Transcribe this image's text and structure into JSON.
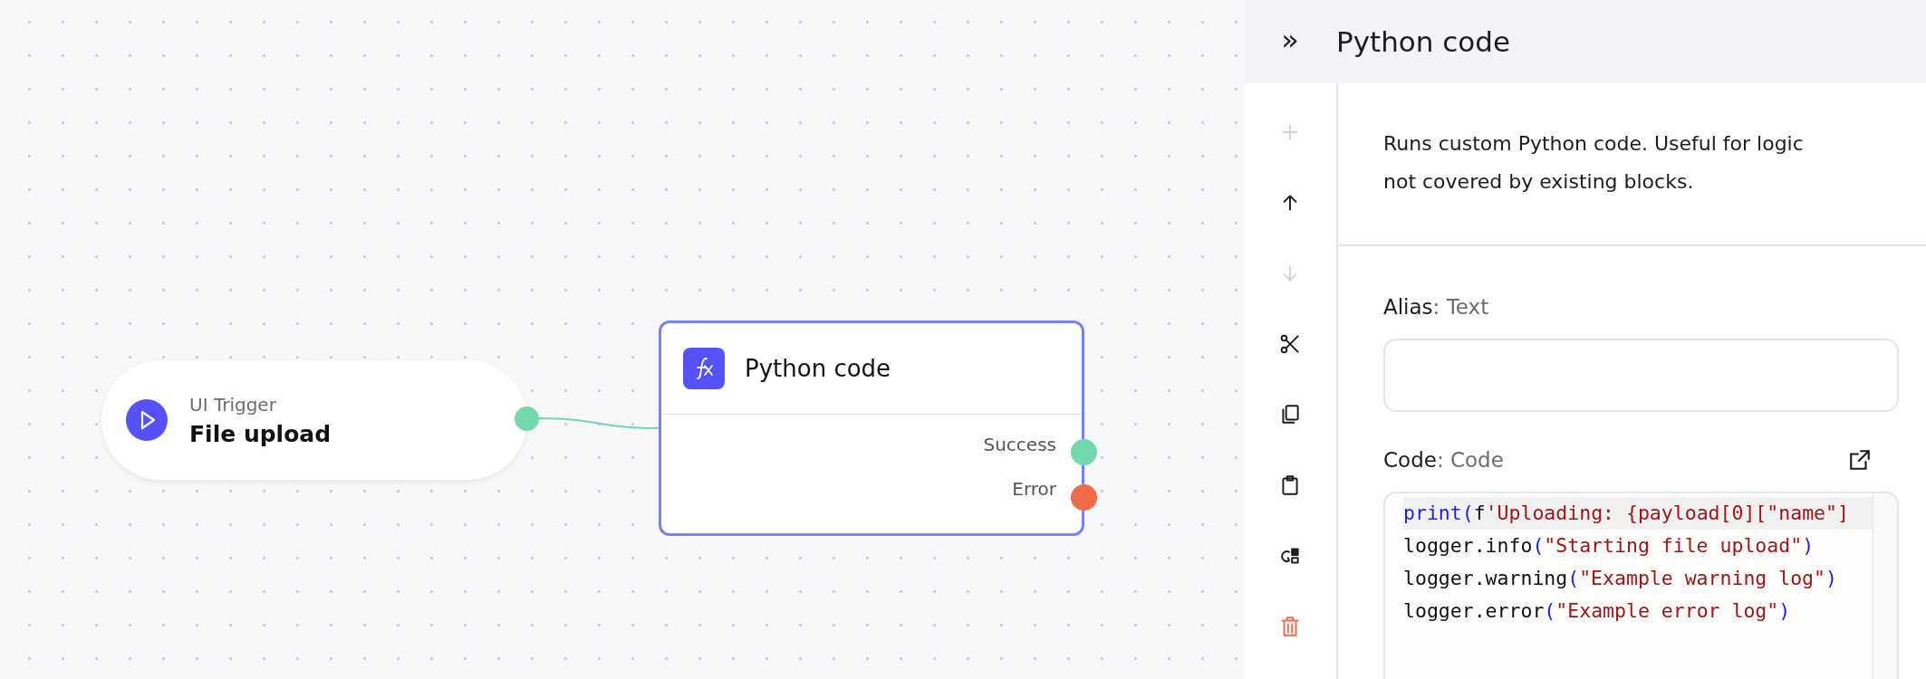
{
  "canvas": {
    "trigger_node": {
      "subtitle": "UI Trigger",
      "title": "File upload"
    },
    "code_node": {
      "title": "Python code",
      "outputs": [
        {
          "label": "Success",
          "color": "#72d8ae"
        },
        {
          "label": "Error",
          "color": "#ef6c47"
        }
      ]
    }
  },
  "panel": {
    "collapse_icon": "»",
    "title": "Python code",
    "toolbar": [
      {
        "kind": "add",
        "disabled": true
      },
      {
        "kind": "up",
        "disabled": false
      },
      {
        "kind": "down",
        "disabled": true
      },
      {
        "kind": "cut",
        "disabled": false
      },
      {
        "kind": "copy",
        "disabled": false
      },
      {
        "kind": "paste",
        "disabled": false
      },
      {
        "kind": "replace",
        "disabled": false
      },
      {
        "kind": "delete",
        "disabled": false
      }
    ],
    "description": "Runs custom Python code. Useful for logic not covered by existing blocks.",
    "fields": [
      {
        "label": "Alias",
        "type": ": Text",
        "kind": "input"
      },
      {
        "label": "Code",
        "type": ": Code",
        "kind": "code",
        "lines": [
          [
            {
              "kind": "keyword",
              "text": "print"
            },
            {
              "kind": "paren",
              "text": "("
            },
            {
              "kind": "plain",
              "text": "f"
            },
            {
              "kind": "string",
              "text": "'Uploading: {payload[0][\"name\"]"
            }
          ],
          [
            {
              "kind": "plain",
              "text": "logger.info"
            },
            {
              "kind": "paren",
              "text": "("
            },
            {
              "kind": "string",
              "text": "\"Starting file upload\""
            },
            {
              "kind": "paren",
              "text": ")"
            }
          ],
          [
            {
              "kind": "plain",
              "text": "logger.warning"
            },
            {
              "kind": "paren",
              "text": "("
            },
            {
              "kind": "string",
              "text": "\"Example warning log\""
            },
            {
              "kind": "paren",
              "text": ")"
            }
          ],
          [
            {
              "kind": "plain",
              "text": "logger.error"
            },
            {
              "kind": "paren",
              "text": "("
            },
            {
              "kind": "string",
              "text": "\"Example error log\""
            },
            {
              "kind": "paren",
              "text": ")"
            }
          ]
        ]
      }
    ]
  }
}
